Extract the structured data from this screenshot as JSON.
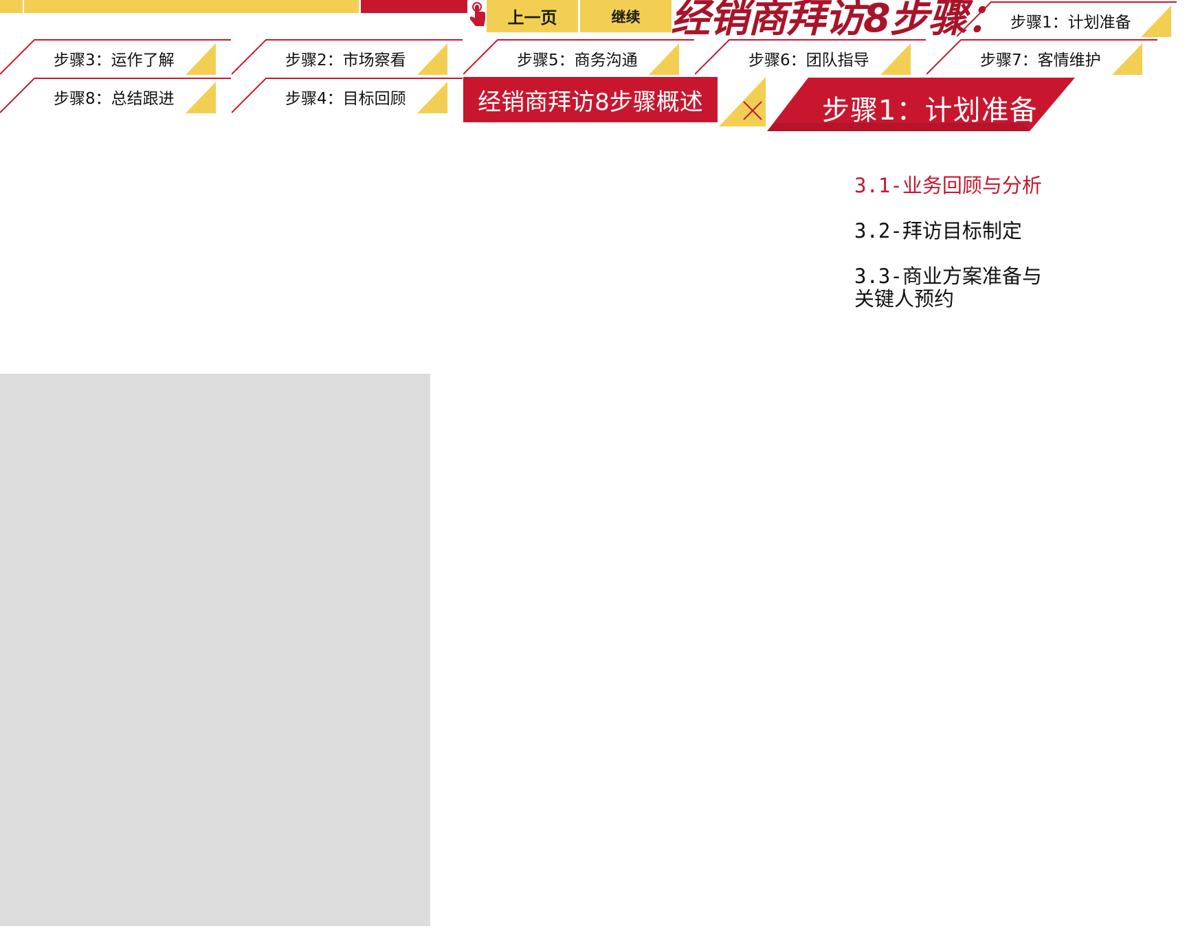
{
  "nav": {
    "prev_label": "上一页",
    "next_label": "继续"
  },
  "header": {
    "title": "经销商拜访8步骤："
  },
  "steps": [
    {
      "label": "步骤1：计划准备"
    },
    {
      "label": "步骤3：运作了解"
    },
    {
      "label": "步骤2：市场察看"
    },
    {
      "label": "步骤5：商务沟通"
    },
    {
      "label": "步骤6：团队指导"
    },
    {
      "label": "步骤7：客情维护"
    },
    {
      "label": "步骤8：总结跟进"
    },
    {
      "label": "步骤4：目标回顾"
    }
  ],
  "overview": {
    "label": "经销商拜访8步骤概述"
  },
  "current_step": {
    "title": "步骤1：计划准备"
  },
  "sub_items": [
    {
      "label": "3.1-业务回顾与分析",
      "active": true
    },
    {
      "label": "3.2-拜访目标制定",
      "active": false
    },
    {
      "label": "3.3-商业方案准备与关键人预约",
      "active": false
    }
  ],
  "colors": {
    "accent_red": "#c8162e",
    "dark_red": "#a8142a",
    "yellow": "#f2cf53",
    "placeholder_gray": "#dcdcdc"
  },
  "icons": {
    "hand": "pointing-hand-icon",
    "close": "close-icon"
  }
}
